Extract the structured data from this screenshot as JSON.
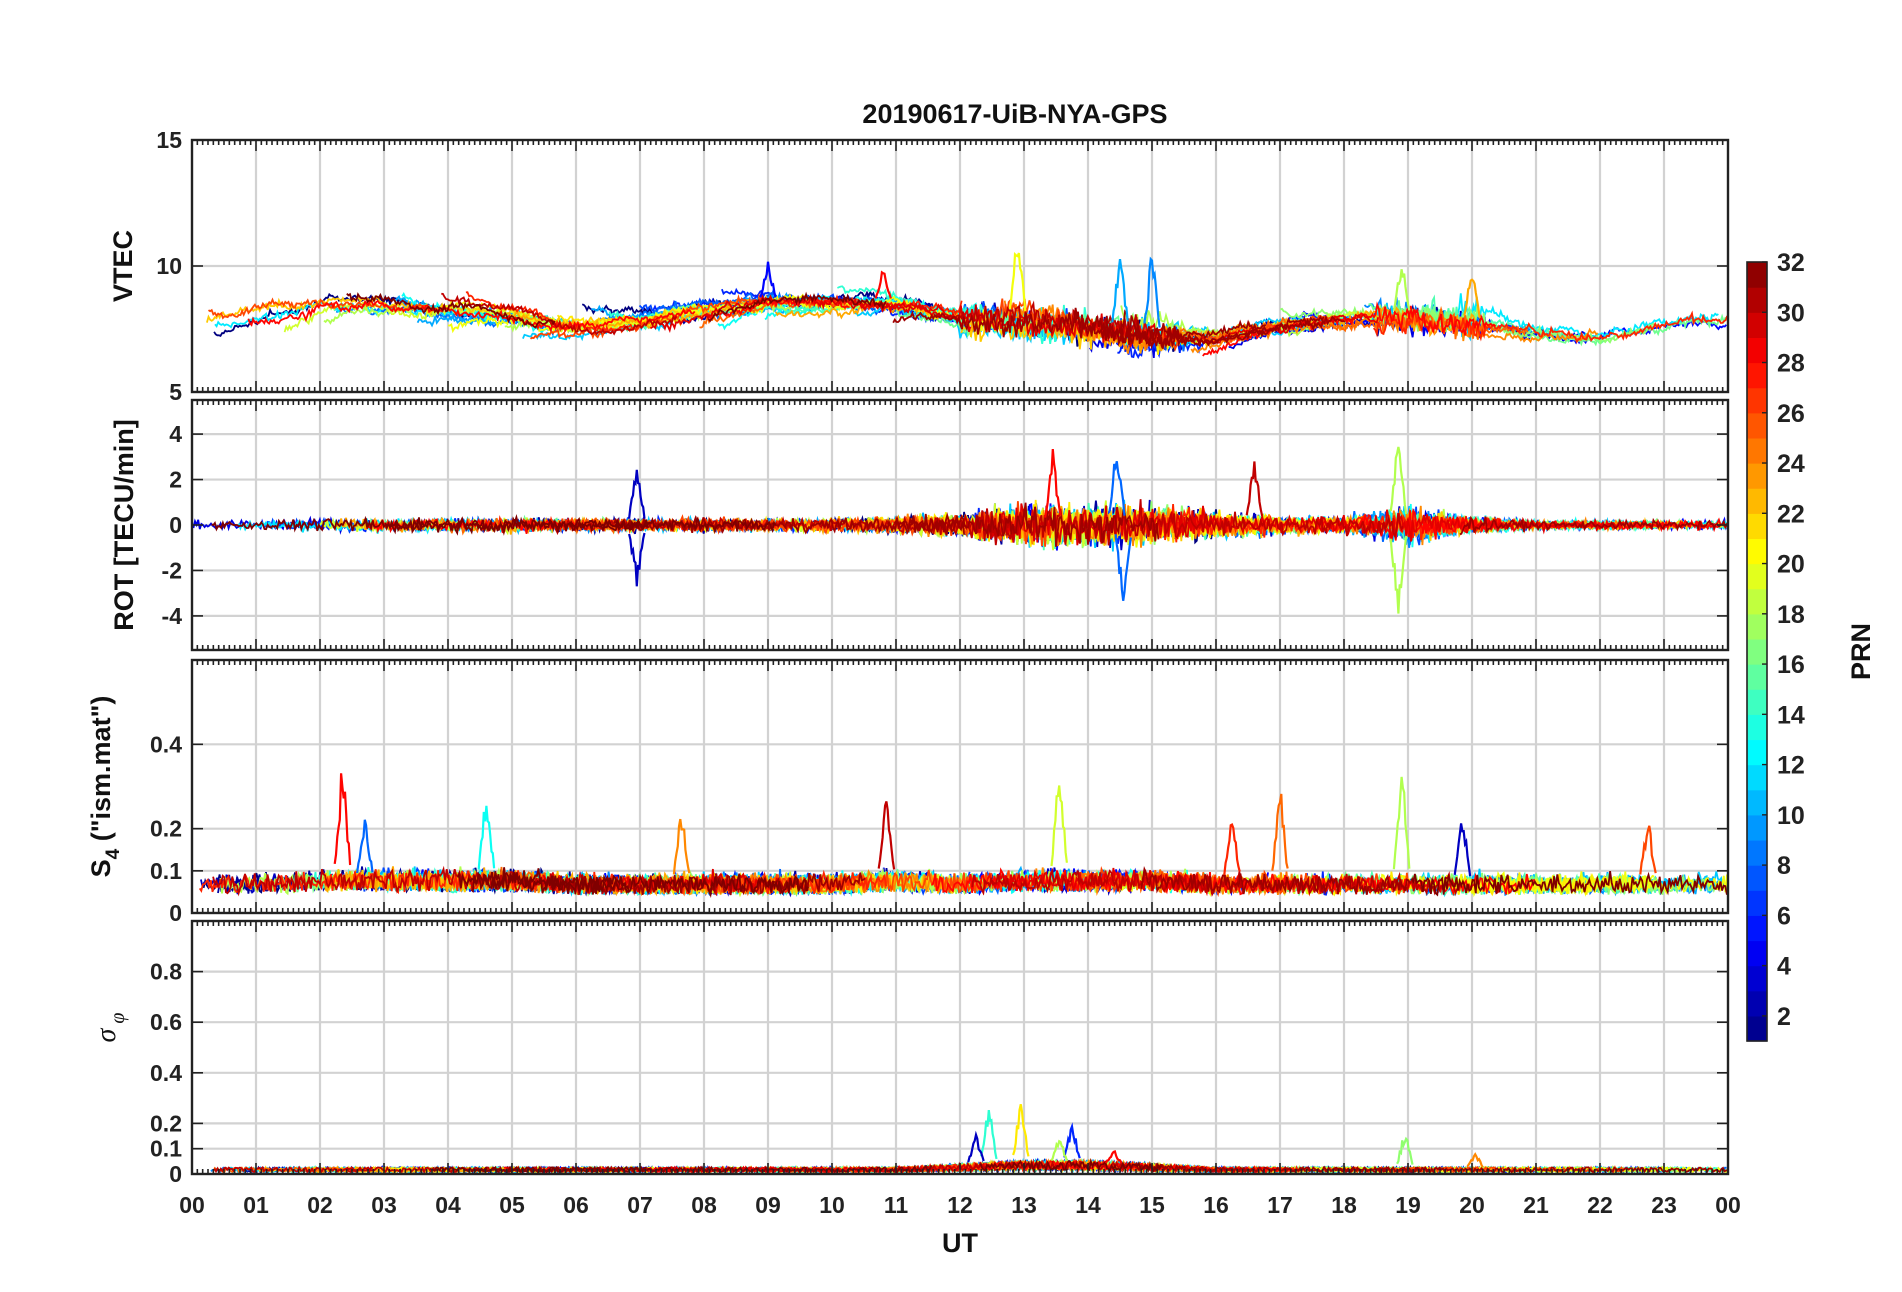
{
  "chart_data": {
    "type": "line",
    "title": "20190617-UiB-NYA-GPS",
    "xlabel": "UT",
    "x_tick_labels": [
      "00",
      "01",
      "02",
      "03",
      "04",
      "05",
      "06",
      "07",
      "08",
      "09",
      "10",
      "11",
      "12",
      "13",
      "14",
      "15",
      "16",
      "17",
      "18",
      "19",
      "20",
      "21",
      "22",
      "23",
      "00"
    ],
    "xlim": [
      0,
      24
    ],
    "grid": true,
    "series_key": "PRN",
    "panels": [
      {
        "ylabel": "VTEC",
        "ylim": [
          5,
          15
        ],
        "y_ticks": [
          5,
          10,
          15
        ],
        "y_tick_labels": [
          "5",
          "10",
          "15"
        ],
        "baseline_by_hour": [
          7.3,
          8.0,
          8.5,
          8.5,
          8.3,
          8.0,
          7.6,
          7.8,
          8.3,
          8.6,
          8.6,
          8.5,
          8.0,
          7.8,
          7.6,
          7.2,
          7.2,
          7.6,
          7.9,
          8.0,
          7.7,
          7.4,
          7.2,
          7.8,
          8.0
        ],
        "events": [
          {
            "ut": 12.9,
            "value": 11.6,
            "prn": 20
          },
          {
            "ut": 14.5,
            "value": 10.9,
            "prn": 10
          },
          {
            "ut": 15.0,
            "value": 10.9,
            "prn": 9
          },
          {
            "ut": 18.9,
            "value": 10.4,
            "prn": 18
          },
          {
            "ut": 20.0,
            "value": 10.2,
            "prn": 23
          },
          {
            "ut": 9.0,
            "value": 10.2,
            "prn": 5
          },
          {
            "ut": 10.8,
            "value": 10.0,
            "prn": 28
          }
        ]
      },
      {
        "ylabel": "ROT [TECU/min]",
        "ylim": [
          -5.5,
          5.5
        ],
        "y_ticks": [
          -4,
          -2,
          0,
          2,
          4
        ],
        "y_tick_labels": [
          "-4",
          "-2",
          "0",
          "2",
          "4"
        ],
        "noise_by_hour": [
          0.35,
          0.35,
          0.45,
          0.45,
          0.5,
          0.5,
          0.45,
          0.45,
          0.45,
          0.45,
          0.5,
          0.6,
          0.8,
          1.5,
          1.6,
          1.4,
          0.9,
          0.7,
          0.6,
          1.4,
          0.6,
          0.3,
          0.3,
          0.3,
          0.3
        ],
        "events": [
          {
            "ut": 6.95,
            "value": 2.9,
            "prn": 3
          },
          {
            "ut": 6.95,
            "value": -2.8,
            "prn": 3
          },
          {
            "ut": 13.45,
            "value": 3.4,
            "prn": 28
          },
          {
            "ut": 14.45,
            "value": 3.9,
            "prn": 8
          },
          {
            "ut": 14.55,
            "value": -3.9,
            "prn": 8
          },
          {
            "ut": 18.85,
            "value": 4.6,
            "prn": 18
          },
          {
            "ut": 18.85,
            "value": -4.5,
            "prn": 18
          },
          {
            "ut": 16.6,
            "value": 3.4,
            "prn": 30
          }
        ]
      },
      {
        "ylabel": "S4 (\"ism.mat\")",
        "ylim": [
          0,
          0.6
        ],
        "y_ticks": [
          0,
          0.1,
          0.2,
          0.4
        ],
        "y_tick_labels": [
          "0",
          "0.1",
          "0.2",
          "0.4"
        ],
        "baseline_by_hour": [
          0.07,
          0.07,
          0.08,
          0.08,
          0.08,
          0.08,
          0.07,
          0.07,
          0.07,
          0.07,
          0.07,
          0.08,
          0.07,
          0.08,
          0.08,
          0.08,
          0.07,
          0.07,
          0.07,
          0.07,
          0.07,
          0.07,
          0.07,
          0.07,
          0.07
        ],
        "events": [
          {
            "ut": 2.35,
            "value": 0.38,
            "prn": 28
          },
          {
            "ut": 13.55,
            "value": 0.39,
            "prn": 19
          },
          {
            "ut": 18.9,
            "value": 0.39,
            "prn": 18
          },
          {
            "ut": 17.0,
            "value": 0.32,
            "prn": 25
          },
          {
            "ut": 4.6,
            "value": 0.31,
            "prn": 13
          },
          {
            "ut": 10.85,
            "value": 0.29,
            "prn": 30
          },
          {
            "ut": 16.25,
            "value": 0.27,
            "prn": 27
          },
          {
            "ut": 7.65,
            "value": 0.26,
            "prn": 24
          },
          {
            "ut": 22.75,
            "value": 0.25,
            "prn": 26
          },
          {
            "ut": 2.7,
            "value": 0.24,
            "prn": 8
          },
          {
            "ut": 19.85,
            "value": 0.25,
            "prn": 3
          }
        ]
      },
      {
        "ylabel": "σ φ",
        "ylim": [
          0,
          1.0
        ],
        "y_ticks": [
          0,
          0.1,
          0.2,
          0.4,
          0.6,
          0.8
        ],
        "y_tick_labels": [
          "0",
          "0.1",
          "0.2",
          "0.4",
          "0.6",
          "0.8"
        ],
        "baseline_by_hour": [
          0.02,
          0.02,
          0.02,
          0.02,
          0.02,
          0.02,
          0.02,
          0.02,
          0.02,
          0.02,
          0.02,
          0.02,
          0.03,
          0.04,
          0.04,
          0.03,
          0.02,
          0.02,
          0.02,
          0.02,
          0.02,
          0.02,
          0.02,
          0.02,
          0.02
        ],
        "events": [
          {
            "ut": 12.45,
            "value": 0.29,
            "prn": 14
          },
          {
            "ut": 12.95,
            "value": 0.31,
            "prn": 21
          },
          {
            "ut": 13.75,
            "value": 0.22,
            "prn": 6
          },
          {
            "ut": 13.55,
            "value": 0.16,
            "prn": 18
          },
          {
            "ut": 12.25,
            "value": 0.17,
            "prn": 3
          },
          {
            "ut": 18.95,
            "value": 0.18,
            "prn": 17
          },
          {
            "ut": 14.4,
            "value": 0.1,
            "prn": 28
          },
          {
            "ut": 20.05,
            "value": 0.09,
            "prn": 24
          }
        ]
      }
    ],
    "colorbar": {
      "label": "PRN",
      "range": [
        1,
        32
      ],
      "tick_labels": [
        "2",
        "4",
        "6",
        "8",
        "10",
        "12",
        "14",
        "16",
        "18",
        "20",
        "22",
        "24",
        "26",
        "28",
        "30",
        "32"
      ],
      "colormap": "jet"
    },
    "prn_count": 32,
    "note_series": "One line per GPS satellite PRN 1-32, colored by PRN using jet colormap"
  }
}
